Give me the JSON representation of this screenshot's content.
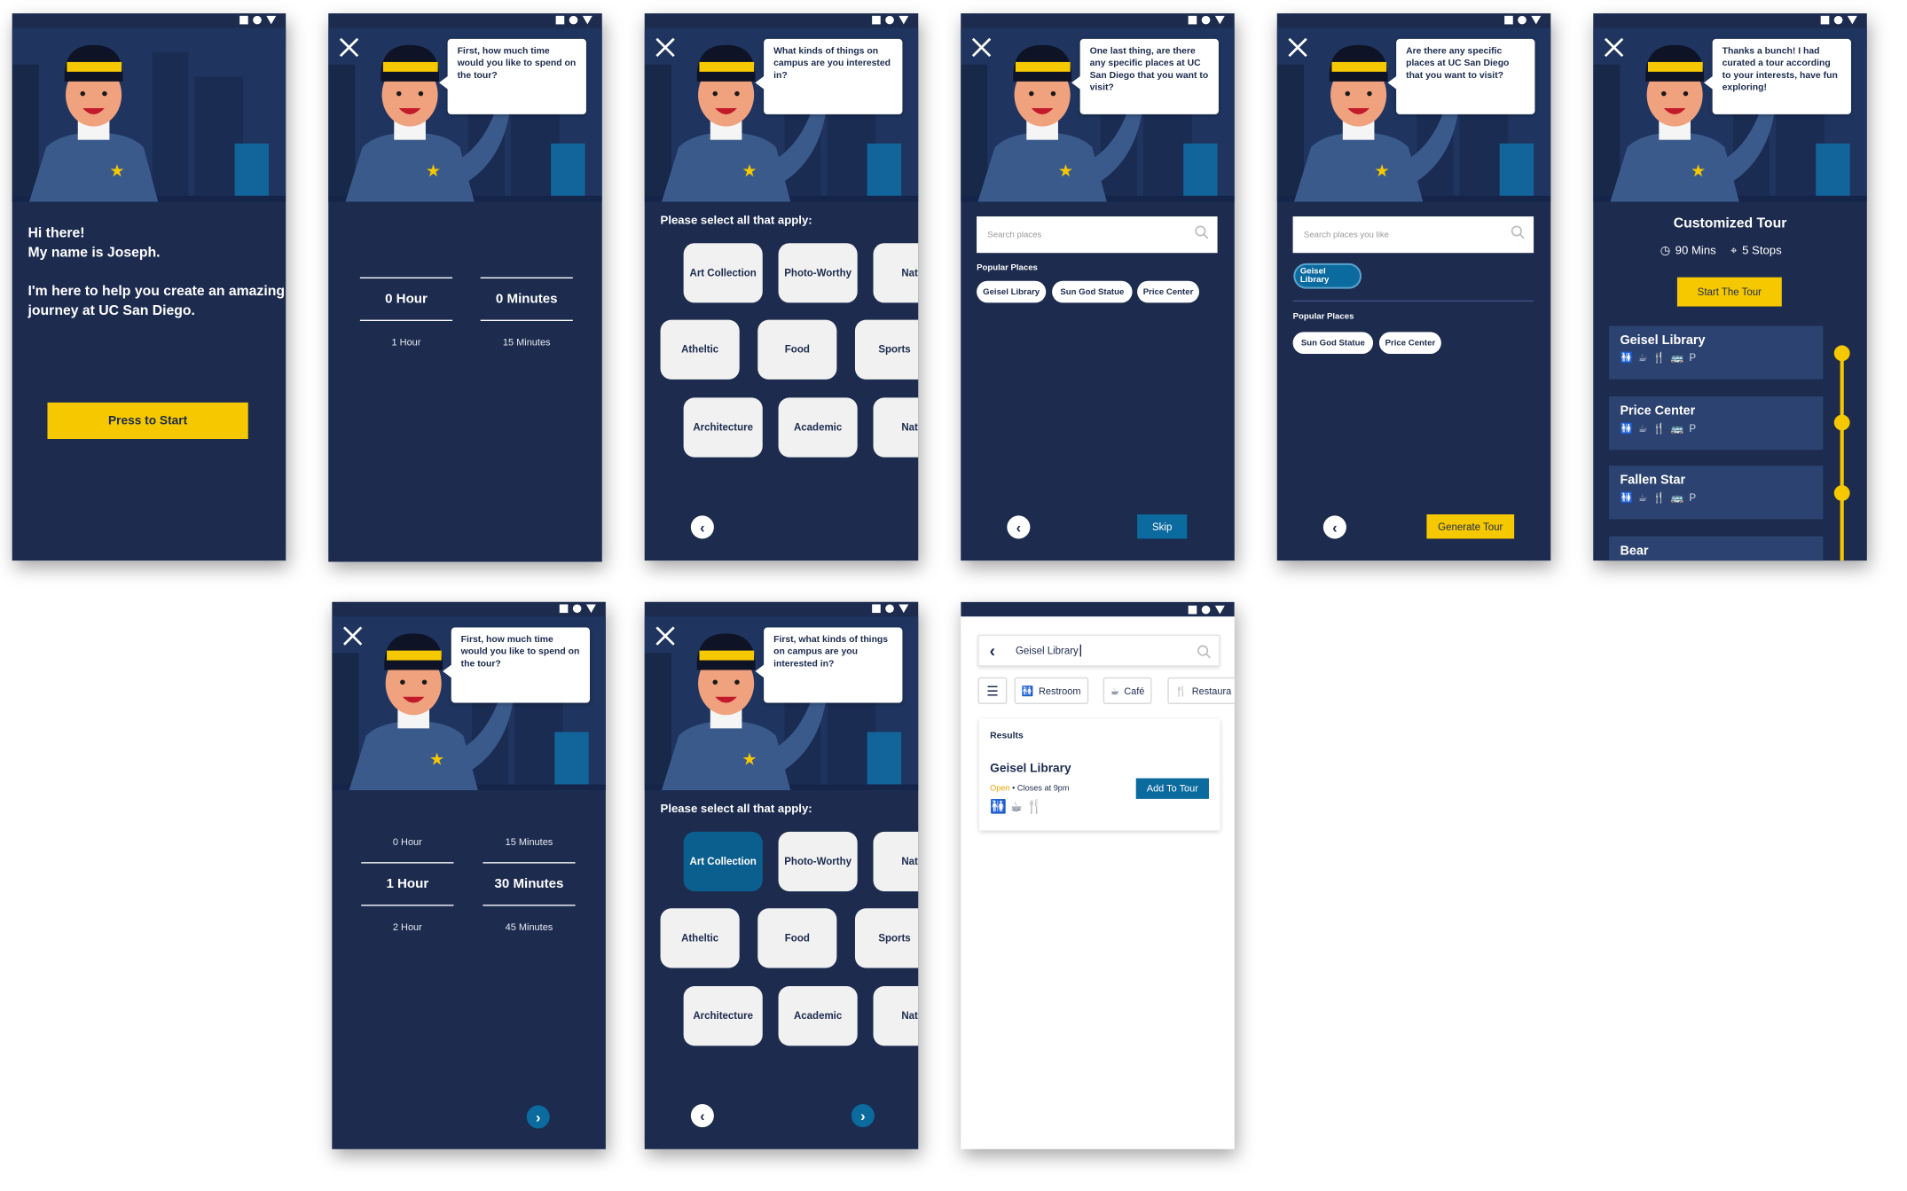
{
  "intro": {
    "greeting": "Hi there!",
    "name_line": "My name is Joseph.",
    "body": "I'm here to help you create an amazing journey at UC San Diego.",
    "start_label": "Press to Start"
  },
  "time_q": "First, how much time would you like to spend on the tour?",
  "time_a": {
    "hours_selected": "0 Hour",
    "minutes_selected": "0 Minutes",
    "hours_next": "1 Hour",
    "minutes_next": "15 Minutes"
  },
  "time_b": {
    "hours_prev": "0 Hour",
    "minutes_prev": "15 Minutes",
    "hours_selected": "1 Hour",
    "minutes_selected": "30 Minutes",
    "hours_next": "2 Hour",
    "minutes_next": "45 Minutes"
  },
  "interest_q": "What kinds of things on campus are you interested in?",
  "interest_q2": "First, what kinds of things on campus are you interested in?",
  "select_prompt": "Please select all that apply:",
  "interests": [
    "Art Collection",
    "Photo-Worthy",
    "Natu",
    "Atheltic",
    "Food",
    "Sports",
    "Architecture",
    "Academic",
    "Natu"
  ],
  "places_q": "One last thing, are there any specific places at UC San Diego that you want to visit?",
  "places_q2": "Are there any specific places at UC San Diego that you want to visit?",
  "search_placeholder": "Search places",
  "search_placeholder2": "Search places you like",
  "popular_label": "Popular Places",
  "popular": [
    "Geisel Library",
    "Sun God Statue",
    "Price Center"
  ],
  "selected_place": "Geisel Library",
  "skip_label": "Skip",
  "generate_label": "Generate Tour",
  "tour": {
    "bubble": "Thanks a bunch! I had curated a tour according to your interests, have fun exploring!",
    "title": "Customized Tour",
    "duration": "90 Mins",
    "stops_count": "5 Stops",
    "start_label": "Start The Tour",
    "stops": [
      "Geisel Library",
      "Price Center",
      "Fallen Star",
      "Bear"
    ],
    "amenity_icons": "🚻 ☕ 🍴 🚌 P"
  },
  "search_screen": {
    "query": "Geisel Library",
    "filters": [
      "Restroom",
      "Café",
      "Restaura"
    ],
    "results_label": "Results",
    "result_name": "Geisel Library",
    "status": "Open",
    "closes": "• Closes at 9pm",
    "add_label": "Add To Tour"
  },
  "colors": {
    "navy": "#1c2b4e",
    "accent_yellow": "#f6c800",
    "accent_blue": "#0b6a9e"
  }
}
